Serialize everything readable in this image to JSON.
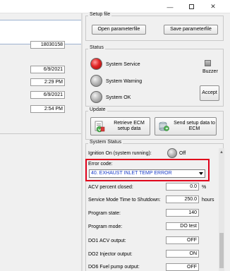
{
  "window": {
    "minimize_glyph": "—",
    "close_glyph": "✕"
  },
  "left_panel": {
    "field_1": "18030158",
    "field_2": "6/9/2021",
    "field_3": "2:29 PM",
    "field_4": "6/9/2021",
    "field_5": "2:54 PM"
  },
  "setup_file": {
    "title": "Setup file",
    "open_label": "Open parameterfile",
    "save_label": "Save parameterfile"
  },
  "status": {
    "title": "Status",
    "service_label": "System Service",
    "warning_label": "System Warning",
    "ok_label": "System OK",
    "buzzer_label": "Buzzer",
    "accept_label": "Accept",
    "colors": {
      "service": "#e02525",
      "warning": "#b4b4b4",
      "ok": "#b4b4b4"
    }
  },
  "update": {
    "title": "Update",
    "retrieve_label": "Retrieve ECM setup data",
    "send_label": "Send setup data to ECM"
  },
  "system_status": {
    "title": "System Status",
    "ignition_label": "Ignition On (system running):",
    "ignition_value": "Off",
    "error_code_label": "Error code:",
    "error_code_value": "40. EXHAUST INLET TEMP ERROR",
    "highlight_color": "#e0001b",
    "rows": [
      {
        "label": "ACV percent closed:",
        "value": "0.0",
        "unit": "%"
      },
      {
        "label": "Service Mode Time to Shutdown:",
        "value": "250.0",
        "unit": "hours"
      },
      {
        "label": "Program state:",
        "value": "140",
        "unit": ""
      },
      {
        "label": "Program mode:",
        "value": "DO test",
        "unit": ""
      },
      {
        "label": "DO1 ACV output:",
        "value": "OFF",
        "unit": ""
      },
      {
        "label": "DO2 Injector output:",
        "value": "ON",
        "unit": ""
      },
      {
        "label": "DO6 Fuel pump output:",
        "value": "OFF",
        "unit": ""
      }
    ]
  }
}
